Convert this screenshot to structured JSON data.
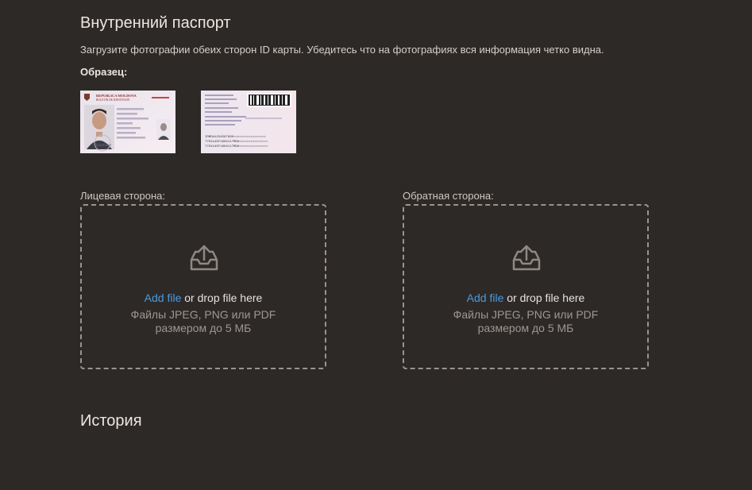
{
  "passport": {
    "title": "Внутренний паспорт",
    "description": "Загрузите фотографии обеих сторон ID карты. Убедитесь что на фотографиях вся информация четко видна.",
    "sample_label": "Образец:",
    "sample_front": {
      "country": "REPUBLICA MOLDOVA",
      "doc_name": "BULETIN DE IDENTITATE",
      "signature": "Ajustare"
    },
    "sample_back": {
      "mrz_line1": "IDMDA1234567890<<<<<<<<<<<<<<<<<",
      "mrz_line2": "7704145F1604117MDA<<<<<<<<<<<<<<<",
      "mrz_line3": "7704145F1604117MDA<<<<<<<<<<<<<<<"
    }
  },
  "uploads": {
    "front": {
      "label": "Лицевая сторона:",
      "add_file": "Add file",
      "drop_text": " or drop file here",
      "hint_line1": "Файлы JPEG, PNG или PDF",
      "hint_line2": "размером до 5 МБ"
    },
    "back": {
      "label": "Обратная сторона:",
      "add_file": "Add file",
      "drop_text": " or drop file here",
      "hint_line1": "Файлы JPEG, PNG или PDF",
      "hint_line2": "размером до 5 МБ"
    }
  },
  "history": {
    "title": "История"
  },
  "colors": {
    "background": "#2d2927",
    "link": "#4a9be0",
    "dashed_border": "#9a938f"
  },
  "icons": {
    "upload": "inbox-upload-icon"
  }
}
